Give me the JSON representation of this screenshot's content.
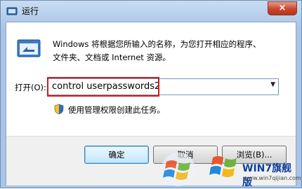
{
  "window": {
    "title": "运行",
    "close_label": "×"
  },
  "dialog": {
    "description_line1": "Windows 将根据您所输入的名称，为您打开相应的程序、",
    "description_line2": "文件夹、文档或 Internet 资源。",
    "open_label": "打开(O):",
    "command_value": "control userpasswords2",
    "admin_note": "使用管理权限创建此任务。"
  },
  "buttons": {
    "ok": "确定",
    "cancel": "取消",
    "browse": "浏览(B)..."
  },
  "watermark": {
    "brand": "WIN7旗舰版",
    "url": "www.win7qijian.com"
  },
  "colors": {
    "highlight_border": "#d01a1a",
    "title_bar": "#a9c4e6",
    "brand": "#0d3f9e"
  }
}
